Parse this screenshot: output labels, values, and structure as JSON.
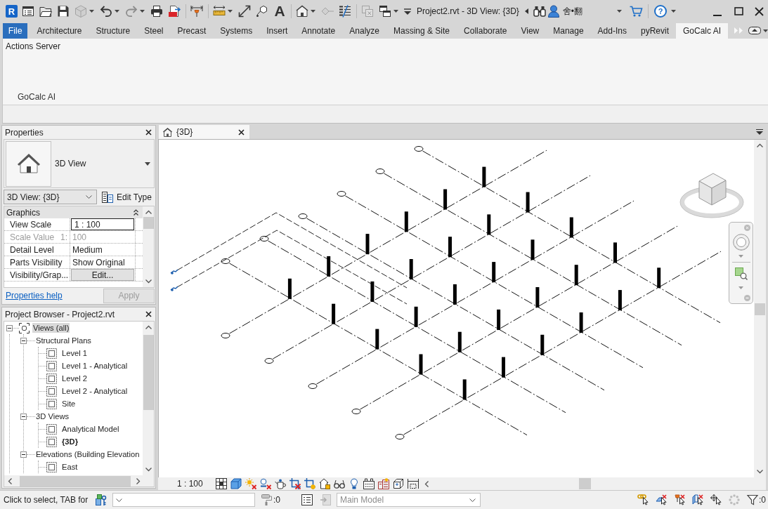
{
  "window": {
    "app_logo": "R",
    "title": "Project2.rvt - 3D View: {3D}",
    "user": "舍•翻",
    "help": "?"
  },
  "quick_access": [
    {
      "disabled": false,
      "dropdown": false
    },
    {
      "disabled": false,
      "dropdown": false
    },
    {
      "disabled": false,
      "dropdown": false
    },
    {
      "disabled": true,
      "dropdown": true
    },
    {
      "disabled": false,
      "dropdown": true
    },
    {
      "disabled": true,
      "dropdown": true
    },
    {
      "disabled": false,
      "dropdown": false
    },
    {
      "disabled": false,
      "dropdown": false
    },
    {
      "disabled": false,
      "dropdown": false
    },
    {
      "disabled": false,
      "dropdown": true
    },
    {
      "disabled": false,
      "dropdown": false
    },
    {
      "disabled": false,
      "dropdown": false
    },
    {
      "label": "A",
      "disabled": false,
      "dropdown": false
    },
    {
      "disabled": false,
      "dropdown": true
    },
    {
      "disabled": true,
      "dropdown": false
    },
    {
      "disabled": false,
      "dropdown": false
    },
    {
      "disabled": true,
      "dropdown": false
    },
    {
      "disabled": false,
      "dropdown": true
    },
    {
      "disabled": false,
      "dropdown": false
    }
  ],
  "ribbon_tabs": [
    {
      "label": "File",
      "kind": "menu",
      "selected": false
    },
    {
      "label": "Architecture",
      "kind": "tab",
      "selected": false
    },
    {
      "label": "Structure",
      "kind": "tab",
      "selected": false
    },
    {
      "label": "Steel",
      "kind": "tab",
      "selected": false
    },
    {
      "label": "Precast",
      "kind": "tab",
      "selected": false
    },
    {
      "label": "Systems",
      "kind": "tab",
      "selected": false
    },
    {
      "label": "Insert",
      "kind": "tab",
      "selected": false
    },
    {
      "label": "Annotate",
      "kind": "tab",
      "selected": false
    },
    {
      "label": "Analyze",
      "kind": "tab",
      "selected": false
    },
    {
      "label": "Massing & Site",
      "kind": "tab",
      "selected": false
    },
    {
      "label": "Collaborate",
      "kind": "tab",
      "selected": false
    },
    {
      "label": "View",
      "kind": "tab",
      "selected": false
    },
    {
      "label": "Manage",
      "kind": "tab",
      "selected": false
    },
    {
      "label": "Add-Ins",
      "kind": "tab",
      "selected": false
    },
    {
      "label": "pyRevit",
      "kind": "tab",
      "selected": false
    },
    {
      "label": "GoCalc AI",
      "kind": "tab",
      "selected": true
    }
  ],
  "ribbon": {
    "buttons": [
      {
        "label": "Actions Server"
      }
    ],
    "panel_title": "GoCalc AI"
  },
  "properties": {
    "title": "Properties",
    "type": "3D View",
    "instance": "3D View: {3D}",
    "edit_type": "Edit Type",
    "groups": [
      {
        "label": "Graphics",
        "expanded": true,
        "rows": [
          {
            "kind": "input",
            "name": "View Scale",
            "value": "1 : 100",
            "disabled": false
          },
          {
            "kind": "text",
            "name": "Scale Value",
            "suffix": "1:",
            "value": "100",
            "disabled": true
          },
          {
            "kind": "text",
            "name": "Detail Level",
            "value": "Medium",
            "disabled": false
          },
          {
            "kind": "text",
            "name": "Parts Visibility",
            "value": "Show Original",
            "disabled": false
          },
          {
            "kind": "button",
            "name": "Visibility/Grap...",
            "value": "Edit...",
            "disabled": false
          }
        ]
      }
    ],
    "help_link": "Properties help",
    "apply": {
      "label": "Apply",
      "disabled": true
    }
  },
  "project_browser": {
    "title": "Project Browser - Project2.rvt",
    "tree": [
      {
        "label": "Views (all)",
        "expanded": true,
        "selected": true,
        "active": false,
        "children": [
          {
            "label": "Structural Plans",
            "expanded": true,
            "selected": false,
            "active": false,
            "children": [
              {
                "label": "Level 1",
                "selected": false,
                "active": false
              },
              {
                "label": "Level 1 - Analytical",
                "selected": false,
                "active": false
              },
              {
                "label": "Level 2",
                "selected": false,
                "active": false
              },
              {
                "label": "Level 2 - Analytical",
                "selected": false,
                "active": false
              },
              {
                "label": "Site",
                "selected": false,
                "active": false
              }
            ]
          },
          {
            "label": "3D Views",
            "expanded": true,
            "selected": false,
            "active": false,
            "children": [
              {
                "label": "Analytical Model",
                "selected": false,
                "active": false
              },
              {
                "label": "{3D}",
                "selected": false,
                "active": true
              }
            ]
          },
          {
            "label": "Elevations (Building Elevation",
            "expanded": true,
            "selected": false,
            "active": false,
            "children": [
              {
                "label": "East",
                "selected": false,
                "active": false
              }
            ]
          }
        ]
      }
    ]
  },
  "view": {
    "tabs": [
      {
        "label": "{3D}",
        "selected": true
      }
    ],
    "scale": "1 : 100"
  },
  "status_bar": {
    "message": "Click to select, TAB for",
    "editable_count": ":0",
    "tools": [
      {
        "disabled": false
      },
      {
        "disabled": true
      }
    ],
    "design_option": {
      "value": "Main Model",
      "disabled": true
    },
    "filter_count": ":0"
  }
}
